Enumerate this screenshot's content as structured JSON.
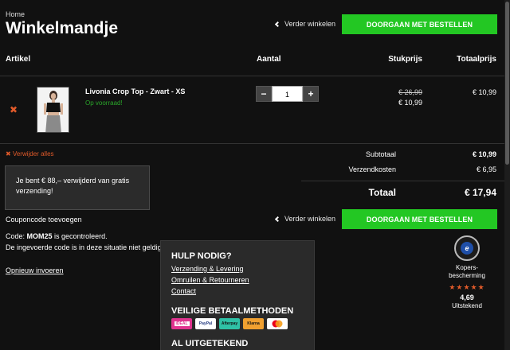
{
  "breadcrumb": "Home",
  "title": "Winkelmandje",
  "continue_label": "Verder winkelen",
  "checkout_label": "DOORGAAN MET BESTELLEN",
  "table": {
    "col_article": "Artikel",
    "col_qty": "Aantal",
    "col_unit": "Stukprijs",
    "col_total": "Totaalprijs"
  },
  "item": {
    "name": "Livonia Crop Top - Zwart - XS",
    "stock": "Op voorraad!",
    "qty": "1",
    "old_price": "€ 26,99",
    "price": "€ 10,99",
    "total": "€ 10,99",
    "minus": "−",
    "plus": "+"
  },
  "remove_all": "Verwijder alles",
  "summary": {
    "subtotal_label": "Subtotaal",
    "subtotal": "€ 10,99",
    "shipping_label": "Verzendkosten",
    "shipping": "€ 6,95",
    "total_label": "Totaal",
    "total": "€ 17,94"
  },
  "notice": "Je bent € 88,– verwijderd van gratis verzending!",
  "coupon": {
    "add_label": "Couponcode toevoegen",
    "msg_prefix": "Code: ",
    "code": "MOM25",
    "msg_suffix": " is gecontroleerd.",
    "error": "De ingevoerde code is in deze situatie niet geldig",
    "reenter": "Opnieuw invoeren"
  },
  "help": {
    "title": "HULP NODIG?",
    "links": [
      "Verzending & Levering",
      "Omruilen & Retourneren",
      "Contact"
    ],
    "pay_title": "VEILIGE BETAALMETHODEN",
    "pay_methods": [
      "iDEAL",
      "PayPal",
      "Afterpay",
      "Klarna",
      "Mastercard"
    ],
    "next_title": "AL UITGETEKEND"
  },
  "trust": {
    "label": "Kopers-bescherming",
    "label_line1": "Kopers-",
    "label_line2": "bescherming",
    "stars": "★★★★★",
    "rating": "4,69",
    "rating_text": "Uitstekend",
    "seal_letter": "e"
  },
  "colors": {
    "accent_green": "#23c723",
    "remove_orange": "#e05a2a",
    "stock_green": "#2aa62a",
    "background": "#111111"
  },
  "icons": {
    "remove": "close-icon",
    "chevron": "chevron-left-icon"
  }
}
